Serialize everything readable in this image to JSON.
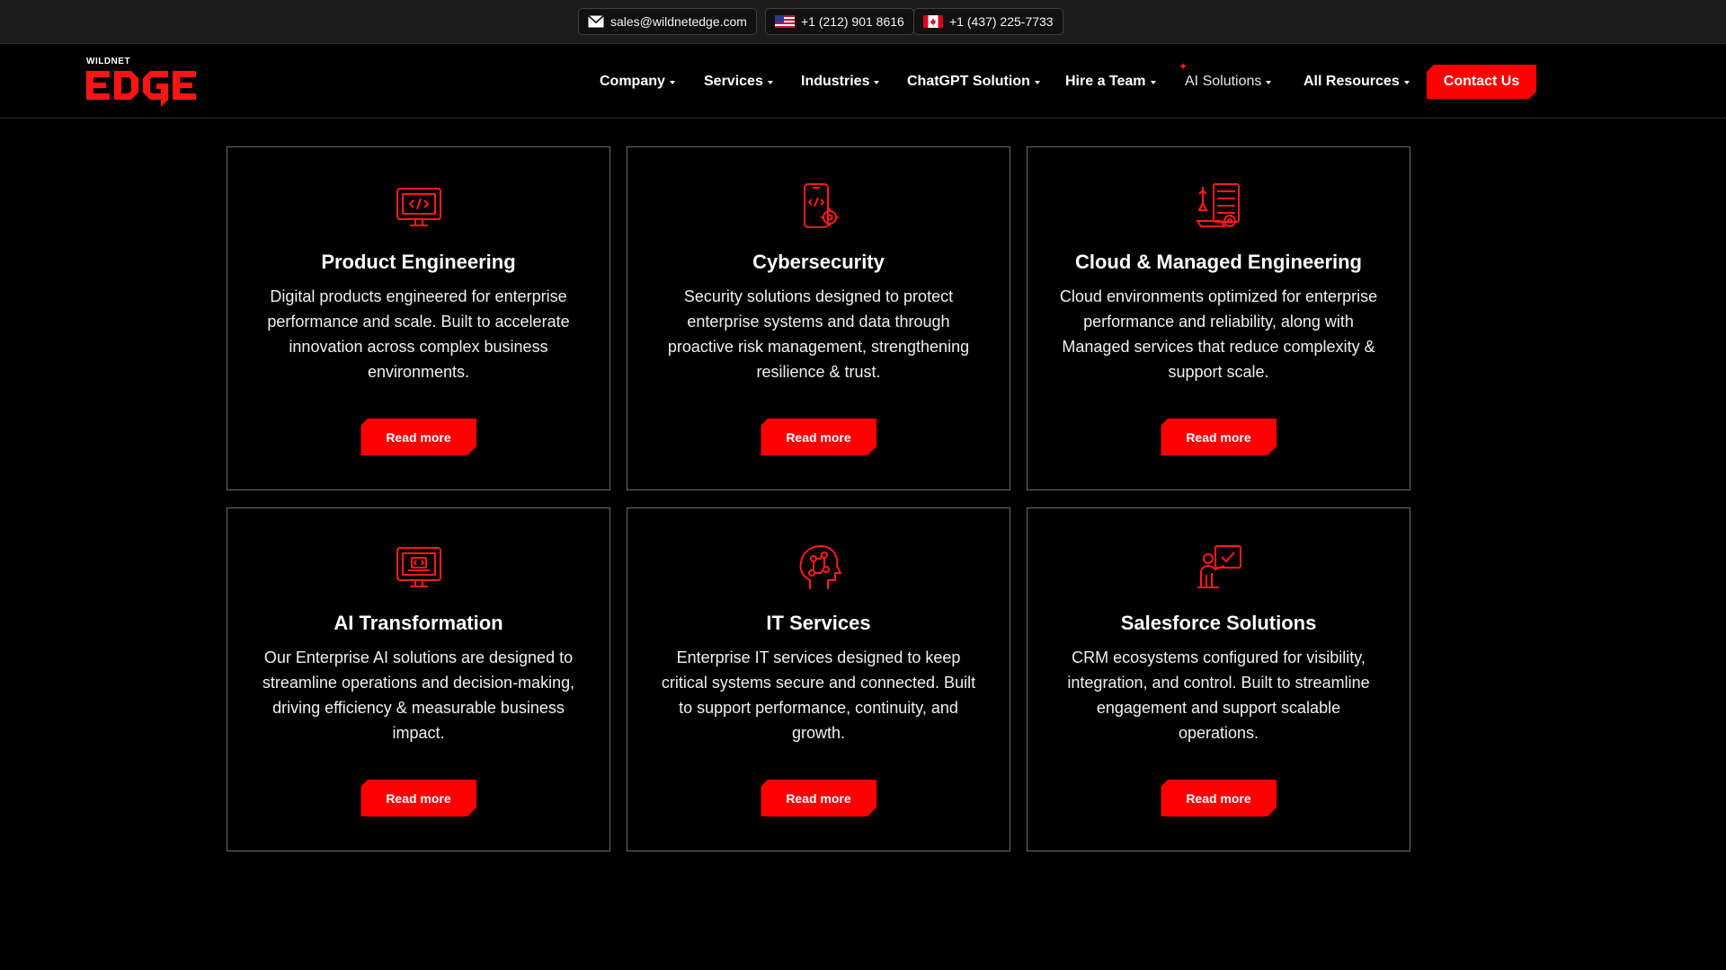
{
  "topbar": {
    "email": "sales@wildnetedge.com",
    "phone_us": "+1 (212) 901 8616",
    "phone_ca": "+1 (437) 225-7733"
  },
  "brand": {
    "small": "WILDNET",
    "big": "EDGE",
    "accent": "#ff0000"
  },
  "nav": {
    "items": [
      {
        "label": "Company"
      },
      {
        "label": "Services"
      },
      {
        "label": "Industries"
      },
      {
        "label": "ChatGPT Solution"
      },
      {
        "label": "Hire a Team"
      },
      {
        "label": "AI Solutions"
      },
      {
        "label": "All Resources"
      }
    ],
    "contact_label": "Contact Us"
  },
  "cards": [
    {
      "title": "Product Engineering",
      "desc": "Digital products engineered for enterprise performance and scale. Built to accelerate innovation across complex business environments.",
      "button": "Read more",
      "icon": "code-monitor-icon"
    },
    {
      "title": "Cybersecurity",
      "desc": "Security solutions designed to protect enterprise systems and data through proactive risk management, strengthening resilience & trust.",
      "button": "Read more",
      "icon": "mobile-code-gear-icon"
    },
    {
      "title": "Cloud & Managed Engineering",
      "desc": "Cloud environments optimized for enterprise performance and reliability, along with Managed services that reduce complexity & support scale.",
      "button": "Read more",
      "icon": "server-tools-icon"
    },
    {
      "title": "AI Transformation",
      "desc": "Our Enterprise AI solutions are designed to streamline operations and decision-making, driving efficiency & measurable business impact.",
      "button": "Read more",
      "icon": "ai-monitor-icon"
    },
    {
      "title": "IT Services",
      "desc": "Enterprise IT services designed to keep critical systems secure and connected. Built to support performance, continuity, and growth.",
      "button": "Read more",
      "icon": "circuit-head-icon"
    },
    {
      "title": "Salesforce Solutions",
      "desc": "CRM ecosystems configured for visibility, integration, and control. Built to streamline engagement and support scalable operations.",
      "button": "Read more",
      "icon": "presenter-check-icon"
    }
  ]
}
